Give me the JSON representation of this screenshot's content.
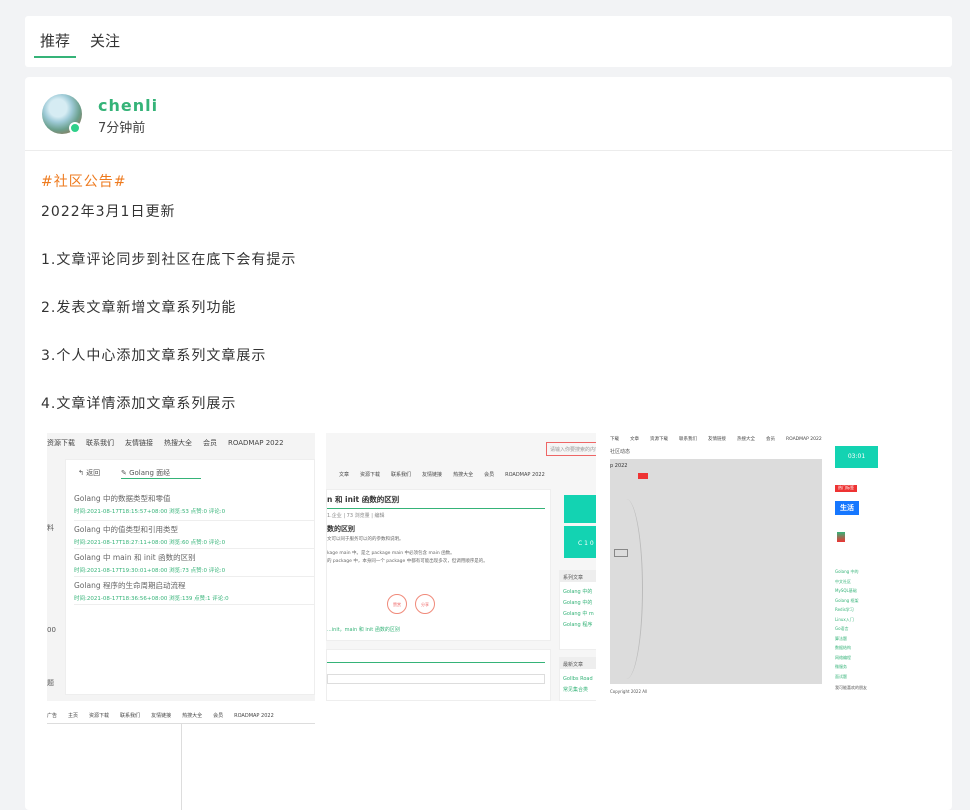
{
  "tabs": {
    "recommended": "推荐",
    "following": "关注"
  },
  "post": {
    "author": "chenli",
    "time_ago": "7分钟前",
    "topic": "#社区公告#",
    "lines": [
      "2022年3月1日更新",
      "1.文章评论同步到社区在底下会有提示",
      "2.发表文章新增文章系列功能",
      "3.个人中心添加文章系列文章展示",
      "4.文章详情添加文章系列展示"
    ]
  },
  "shot1": {
    "nav": [
      "资源下载",
      "联系我们",
      "友情链接",
      "热搜大全",
      "会员",
      "ROADMAP 2022"
    ],
    "back": "返回",
    "series_tab": "Golang 面经",
    "side_left": [
      "料",
      "00",
      "题"
    ],
    "items": [
      {
        "title": "Golang 中的数据类型和零值",
        "meta": "时间:2021-08-17T18:15:57+08:00 浏览:53 点赞:0 评论:0"
      },
      {
        "title": "Golang 中的值类型和引用类型",
        "meta": "时间:2021-08-17T18:27:11+08:00 浏览:60 点赞:0 评论:0"
      },
      {
        "title": "Golang 中 main 和 init 函数的区别",
        "meta": "时间:2021-08-17T19:30:01+08:00 浏览:73 点赞:0 评论:0"
      },
      {
        "title": "Golang 程序的生命周期启动流程",
        "meta": "时间:2021-08-17T18:36:56+08:00 浏览:139 点赞:1 评论:0"
      }
    ]
  },
  "shot1b": {
    "nav": [
      "广告",
      "主页",
      "资源下载",
      "联系我们",
      "友情链接",
      "热搜大全",
      "会员",
      "ROADMAP 2022"
    ]
  },
  "shot2": {
    "nav": [
      "文章",
      "资源下载",
      "联系我们",
      "友情链接",
      "热搜大全",
      "会员",
      "ROADMAP 2022"
    ],
    "search_placeholder": "请输入你要搜索的内容",
    "title": "n 和 init 函数的区别",
    "meta": [
      "",
      "1.企业",
      "73 浏览量",
      "编辑"
    ],
    "subtitle": "数的区别",
    "body1": "文可以同于服务可以的的参数和说明。",
    "body2": "kage main 中。是之 package main 中必须包含 main 函数。",
    "body3": "的 package 中，本身同一个 package 中都有可能出现多次，但调用顺序是的。",
    "like_label": "赞赏",
    "share_label": "分享",
    "prev_link": "...init，main 和 init 函数的区别",
    "sidebar_header": "系列文章",
    "sidebar_items": [
      "Golang 中的",
      "Golang 中的",
      "Golang 中 m",
      "Golang 程序"
    ],
    "sidebar_header2": "最新文章",
    "sidebar_items2": [
      "Gollbs Road",
      "常见集合类"
    ],
    "counter": "C 1 0"
  },
  "shot3": {
    "nav": [
      "下载",
      "文章",
      "资源下载",
      "联系我们",
      "友情链接",
      "热搜大全",
      "会员",
      "ROADMAP 2022"
    ],
    "subtitle": "社区动态",
    "heading": "p 2022",
    "counter": "03:01",
    "life_label": "生活",
    "tag_label": "热门标签",
    "links": [
      "Golang 中的",
      "中文社区",
      "MySQL基础",
      "Golang 框架",
      "Redis学习",
      "Linux入门",
      "Go语言",
      "算法题",
      "数据结构",
      "网络编程",
      "微服务",
      "面试题"
    ],
    "footer": "Copyright 2022 All",
    "footer_right": "我可能喜欢的朋友"
  }
}
